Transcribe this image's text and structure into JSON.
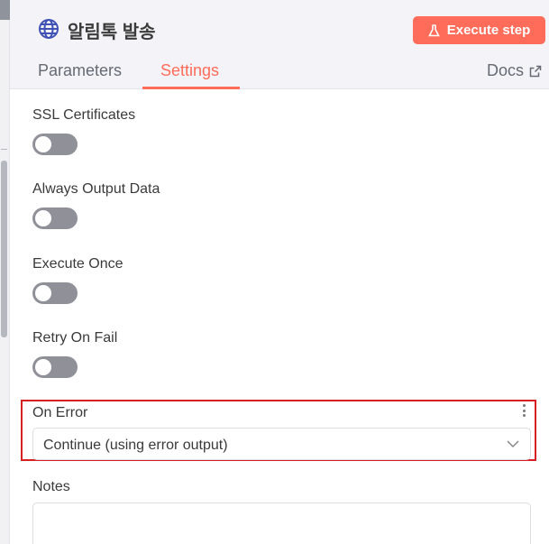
{
  "header": {
    "title": "알림톡 발송",
    "node_icon": "globe-icon",
    "execute_label": "Execute step",
    "execute_icon": "flask-icon"
  },
  "tabs": [
    {
      "label": "Parameters",
      "active": false
    },
    {
      "label": "Settings",
      "active": true
    }
  ],
  "docs": {
    "label": "Docs",
    "icon": "external-link-icon"
  },
  "settings": {
    "ssl_label": "SSL Certificates",
    "ssl_value": false,
    "always_output_label": "Always Output Data",
    "always_output_value": false,
    "execute_once_label": "Execute Once",
    "execute_once_value": false,
    "retry_label": "Retry On Fail",
    "retry_value": false,
    "on_error_label": "On Error",
    "on_error_value": "Continue (using error output)",
    "notes_label": "Notes",
    "notes_value": ""
  },
  "colors": {
    "accent": "#ff6d5a",
    "highlight": "#d62024",
    "toggle_off": "#909198"
  }
}
